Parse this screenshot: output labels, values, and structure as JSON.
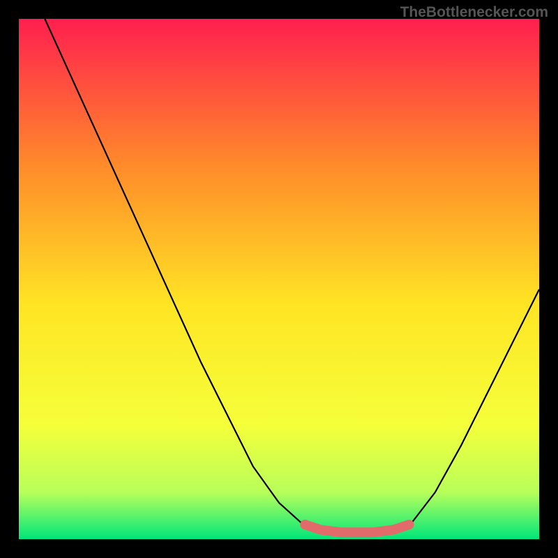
{
  "watermark": "TheBottlenecker.com",
  "chart_data": {
    "type": "line",
    "title": "",
    "xlabel": "",
    "ylabel": "",
    "xlim": [
      0,
      100
    ],
    "ylim": [
      0,
      100
    ],
    "gradient_colors": {
      "top": "#ff1f4f",
      "upper_mid": "#ff8a2a",
      "mid": "#ffe524",
      "lower_mid": "#f5ff3a",
      "low": "#b8ff5a",
      "bottom": "#00e67a"
    },
    "series": [
      {
        "name": "bottleneck-curve",
        "color": "#000000",
        "points": [
          {
            "x": 5,
            "y": 100
          },
          {
            "x": 10,
            "y": 89
          },
          {
            "x": 15,
            "y": 78
          },
          {
            "x": 20,
            "y": 67
          },
          {
            "x": 25,
            "y": 56
          },
          {
            "x": 30,
            "y": 45
          },
          {
            "x": 35,
            "y": 34
          },
          {
            "x": 40,
            "y": 24
          },
          {
            "x": 45,
            "y": 14
          },
          {
            "x": 50,
            "y": 7
          },
          {
            "x": 55,
            "y": 2.5
          },
          {
            "x": 58,
            "y": 1.2
          },
          {
            "x": 62,
            "y": 1
          },
          {
            "x": 68,
            "y": 1
          },
          {
            "x": 72,
            "y": 1.2
          },
          {
            "x": 75,
            "y": 2.5
          },
          {
            "x": 80,
            "y": 9
          },
          {
            "x": 85,
            "y": 18
          },
          {
            "x": 90,
            "y": 28
          },
          {
            "x": 95,
            "y": 38
          },
          {
            "x": 100,
            "y": 48
          }
        ]
      },
      {
        "name": "optimal-band",
        "color": "#e26a6a",
        "points": [
          {
            "x": 55,
            "y": 2.8
          },
          {
            "x": 58,
            "y": 1.8
          },
          {
            "x": 62,
            "y": 1.3
          },
          {
            "x": 68,
            "y": 1.3
          },
          {
            "x": 72,
            "y": 1.8
          },
          {
            "x": 75,
            "y": 2.8
          }
        ]
      }
    ]
  }
}
